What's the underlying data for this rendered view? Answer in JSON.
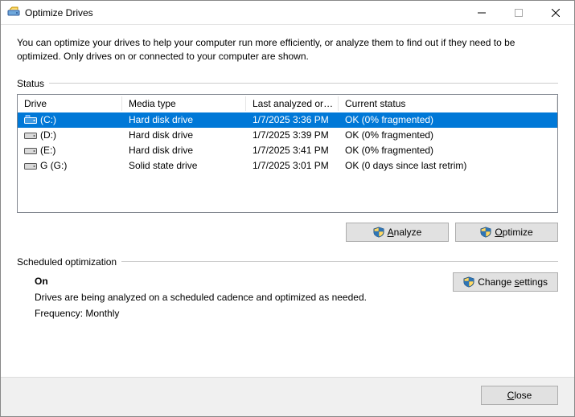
{
  "window": {
    "title": "Optimize Drives"
  },
  "intro": "You can optimize your drives to help your computer run more efficiently, or analyze them to find out if they need to be optimized. Only drives on or connected to your computer are shown.",
  "status": {
    "label": "Status",
    "columns": {
      "drive": "Drive",
      "media": "Media type",
      "last": "Last analyzed or o...",
      "current": "Current status"
    },
    "rows": [
      {
        "name": "(C:)",
        "media": "Hard disk drive",
        "last": "1/7/2025 3:36 PM",
        "status": "OK (0% fragmented)",
        "selected": true,
        "kind": "hdd-win"
      },
      {
        "name": "(D:)",
        "media": "Hard disk drive",
        "last": "1/7/2025 3:39 PM",
        "status": "OK (0% fragmented)",
        "selected": false,
        "kind": "hdd"
      },
      {
        "name": "(E:)",
        "media": "Hard disk drive",
        "last": "1/7/2025 3:41 PM",
        "status": "OK (0% fragmented)",
        "selected": false,
        "kind": "hdd"
      },
      {
        "name": "G (G:)",
        "media": "Solid state drive",
        "last": "1/7/2025 3:01 PM",
        "status": "OK (0 days since last retrim)",
        "selected": false,
        "kind": "ssd"
      }
    ]
  },
  "buttons": {
    "analyze": "Analyze",
    "optimize": "Optimize",
    "change_settings": "Change settings",
    "close": "Close"
  },
  "schedule": {
    "label": "Scheduled optimization",
    "state": "On",
    "desc": "Drives are being analyzed on a scheduled cadence and optimized as needed.",
    "freq": "Frequency: Monthly"
  }
}
